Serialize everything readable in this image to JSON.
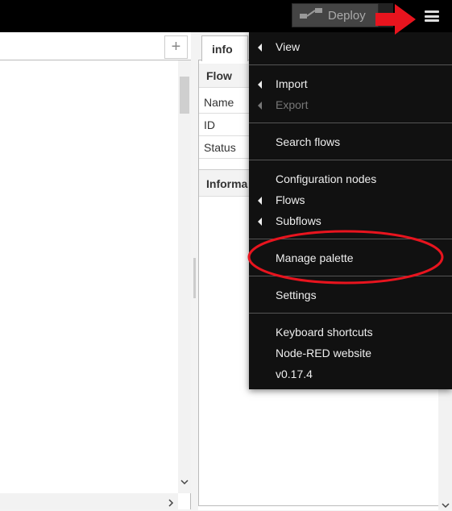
{
  "header": {
    "deploy_label": "Deploy"
  },
  "workspace": {
    "add_tab_label": "+",
    "scroll_down": "⌄",
    "scroll_right": "›"
  },
  "sidebar": {
    "tab_info": "info",
    "flow_section": "Flow",
    "props": [
      "Name",
      "ID",
      "Status"
    ],
    "info_section": "Informa"
  },
  "menu": {
    "items": [
      {
        "label": "View",
        "submenu": true,
        "disabled": false
      },
      {
        "label": "Import",
        "submenu": true,
        "disabled": false
      },
      {
        "label": "Export",
        "submenu": true,
        "disabled": true
      },
      {
        "label": "Search flows",
        "submenu": false,
        "disabled": false
      },
      {
        "label": "Configuration nodes",
        "submenu": false,
        "disabled": false
      },
      {
        "label": "Flows",
        "submenu": true,
        "disabled": false
      },
      {
        "label": "Subflows",
        "submenu": true,
        "disabled": false
      },
      {
        "label": "Manage palette",
        "submenu": false,
        "disabled": false
      },
      {
        "label": "Settings",
        "submenu": false,
        "disabled": false
      },
      {
        "label": "Keyboard shortcuts",
        "submenu": false,
        "disabled": false
      },
      {
        "label": "Node-RED website",
        "submenu": false,
        "disabled": false
      },
      {
        "label": "v0.17.4",
        "submenu": false,
        "disabled": false
      }
    ]
  },
  "colors": {
    "header_bg": "#000000",
    "menu_bg": "#111111",
    "annotation_red": "#e8141e"
  }
}
